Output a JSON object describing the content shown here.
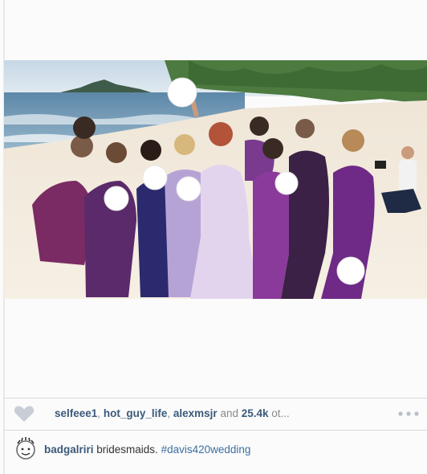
{
  "post": {
    "likes": {
      "users": [
        "selfeee1",
        "hot_guy_life",
        "alexmsjr"
      ],
      "separator": ",",
      "joiner": "and",
      "count": "25.4k",
      "suffix": "ot..."
    },
    "caption": {
      "author": "badgalriri",
      "text": "bridesmaids.",
      "hashtag": "#davis420wedding"
    }
  },
  "icons": {
    "like": "heart-icon",
    "more": "more-options-icon",
    "avatar": "avatar-icon"
  },
  "colors": {
    "link": "#3b5a7a",
    "hashtag": "#3b6fa0",
    "meta": "#8a8a8a",
    "heart": "#c9ced6"
  }
}
